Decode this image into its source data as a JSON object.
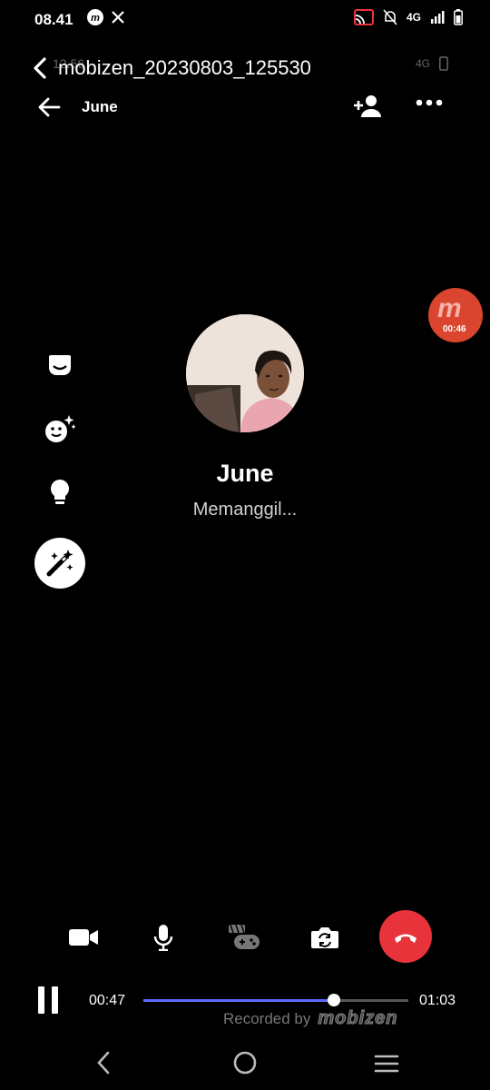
{
  "status_bar": {
    "time": "08.41",
    "network": "4G"
  },
  "video_title": {
    "label": "mobizen_20230803_125530"
  },
  "ghost_status": {
    "time": "12.56",
    "network": "4G"
  },
  "call": {
    "contact_name_header": "June",
    "contact_name": "June",
    "status_text": "Memanggil..."
  },
  "mobizen_bubble": {
    "logo": "m",
    "timer": "00:46"
  },
  "player": {
    "elapsed": "00:47",
    "total": "01:03",
    "progress": 0.72
  },
  "watermark": {
    "text": "Recorded by",
    "brand": "mobizen"
  },
  "icons": {
    "side_tools": [
      "chat-bubble-icon",
      "sparkle-face-icon",
      "lightbulb-icon",
      "magic-wand-icon"
    ],
    "controls": [
      "video-camera-icon",
      "microphone-icon",
      "gamepad-icon",
      "switch-camera-icon",
      "end-call-icon"
    ],
    "nav": [
      "back-nav-icon",
      "home-nav-icon",
      "recents-nav-icon"
    ]
  },
  "colors": {
    "end_call": "#e8333b",
    "progress": "#5d6bff",
    "mobizen": "#d9452f"
  }
}
